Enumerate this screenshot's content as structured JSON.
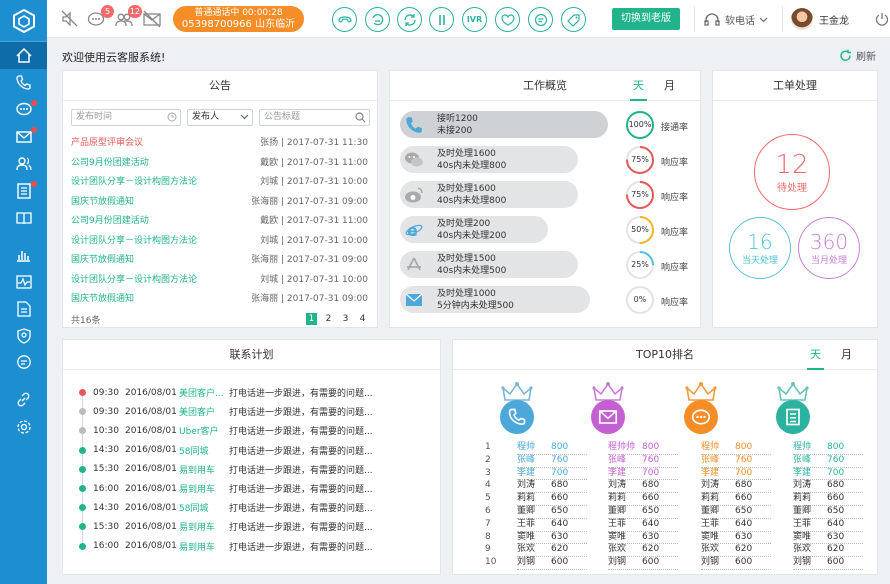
{
  "topbar": {
    "sms_badge": "5",
    "contacts_badge": "12",
    "call_status": "普通通话中 00:00:28",
    "call_number": "05398700966 山东临沂",
    "ivr_label": "IVR",
    "switch_old": "切换到老版",
    "softphone": "软电话",
    "user_name": "王金龙"
  },
  "welcome": "欢迎使用云客服系统!",
  "refresh": "刷新",
  "notice": {
    "title": "公告",
    "filter_time": "发布时间",
    "filter_person": "发布人",
    "filter_title": "公告标题",
    "items": [
      {
        "title": "产品原型评审会议",
        "meta": "张扬 | 2017-07-31 11:30",
        "red": true
      },
      {
        "title": "公司9月份团建活动",
        "meta": "戴欧 | 2017-07-31 11:00",
        "red": false
      },
      {
        "title": "设计团队分享－设计构图方法论",
        "meta": "刘城 | 2017-07-31 10:00",
        "red": false
      },
      {
        "title": "国庆节放假通知",
        "meta": "张海丽 | 2017-07-31 09:00",
        "red": false
      },
      {
        "title": "公司9月份团建活动",
        "meta": "戴欧 | 2017-07-31 11:00",
        "red": false
      },
      {
        "title": "设计团队分享－设计构图方法论",
        "meta": "刘城 | 2017-07-31 10:00",
        "red": false
      },
      {
        "title": "国庆节放假通知",
        "meta": "张海丽 | 2017-07-31 09:00",
        "red": false
      },
      {
        "title": "设计团队分享－设计构图方法论",
        "meta": "刘城 | 2017-07-31 10:00",
        "red": false
      },
      {
        "title": "国庆节放假通知",
        "meta": "张海丽 | 2017-07-31 09:00",
        "red": false
      }
    ],
    "total": "共16条",
    "pages": [
      "1",
      "2",
      "3",
      "4"
    ]
  },
  "overview": {
    "title": "工作概览",
    "tab_day": "天",
    "tab_month": "月",
    "rows": [
      {
        "icon": "phone-icon",
        "l1": "接听1200",
        "l2": "未接200",
        "pct": 100,
        "pct_label": "100%",
        "label": "接通率",
        "color": "#21b48a",
        "bar": "#cfd2d5"
      },
      {
        "icon": "wechat-icon",
        "l1": "及时处理1600",
        "l2": "40s内未处理800",
        "pct": 75,
        "pct_label": "75%",
        "label": "响应率",
        "color": "#e85757"
      },
      {
        "icon": "weibo-icon",
        "l1": "及时处理1600",
        "l2": "40s内未处理800",
        "pct": 75,
        "pct_label": "75%",
        "label": "响应率",
        "color": "#e85757"
      },
      {
        "icon": "ie-icon",
        "l1": "及时处理200",
        "l2": "40s内未处理200",
        "pct": 50,
        "pct_label": "50%",
        "label": "响应率",
        "color": "#f2b724"
      },
      {
        "icon": "app-icon",
        "l1": "及时处理1500",
        "l2": "40s内未处理500",
        "pct": 25,
        "pct_label": "25%",
        "label": "响应率",
        "color": "#4fc3d9"
      },
      {
        "icon": "mail-icon",
        "l1": "及时处理1000",
        "l2": "5分钟内未处理500",
        "pct": 0,
        "pct_label": "0%",
        "label": "响应率",
        "color": "#bbbbbb"
      }
    ]
  },
  "workorder": {
    "title": "工单处理",
    "pending": {
      "num": "12",
      "label": "待处理"
    },
    "today": {
      "num": "16",
      "label": "当天处理"
    },
    "month": {
      "num": "360",
      "label": "当月处理"
    }
  },
  "plan": {
    "title": "联系计划",
    "rows": [
      {
        "time": "09:30",
        "date": "2016/08/01",
        "customer": "美团客户...",
        "desc": "打电话进一步跟进，有需要的问题...",
        "dot": "#e85757"
      },
      {
        "time": "09:30",
        "date": "2016/08/01",
        "customer": "美团客户",
        "desc": "打电话进一步跟进，有需要的问题...",
        "dot": "#bbbbbb"
      },
      {
        "time": "10:30",
        "date": "2016/08/01",
        "customer": "Uber客户",
        "desc": "打电话进一步跟进，有需要的问题...",
        "dot": "#bbbbbb"
      },
      {
        "time": "14:30",
        "date": "2016/08/01",
        "customer": "58同城",
        "desc": "打电话进一步跟进，有需要的问题...",
        "dot": "#21b48a"
      },
      {
        "time": "15:30",
        "date": "2016/08/01",
        "customer": "易到用车",
        "desc": "打电话进一步跟进，有需要的问题...",
        "dot": "#21b48a"
      },
      {
        "time": "16:00",
        "date": "2016/08/01",
        "customer": "易到用车",
        "desc": "打电话进一步跟进，有需要的问题...",
        "dot": "#21b48a"
      },
      {
        "time": "14:30",
        "date": "2016/08/01",
        "customer": "58同城",
        "desc": "打电话进一步跟进，有需要的问题...",
        "dot": "#21b48a"
      },
      {
        "time": "15:30",
        "date": "2016/08/01",
        "customer": "易到用车",
        "desc": "打电话进一步跟进，有需要的问题...",
        "dot": "#21b48a"
      },
      {
        "time": "16:00",
        "date": "2016/08/01",
        "customer": "易到用车",
        "desc": "打电话进一步跟进，有需要的问题...",
        "dot": "#21b48a"
      }
    ]
  },
  "top10": {
    "title": "TOP10排名",
    "tab_day": "天",
    "tab_month": "月",
    "columns": [
      {
        "icon": "phone-icon",
        "color": "#4ba8d8",
        "crown": "#7bb6d9",
        "rows": [
          [
            "程帅",
            "800"
          ],
          [
            "张峰",
            "760"
          ],
          [
            "李建",
            "700"
          ],
          [
            "刘涛",
            "680"
          ],
          [
            "莉莉",
            "660"
          ],
          [
            "董卿",
            "650"
          ],
          [
            "王菲",
            "640"
          ],
          [
            "窦唯",
            "630"
          ],
          [
            "张欢",
            "620"
          ],
          [
            "刘钢",
            "600"
          ]
        ]
      },
      {
        "icon": "mail-icon",
        "color": "#c45fd1",
        "crown": "#c77fd6",
        "rows": [
          [
            "程帅帅",
            "800"
          ],
          [
            "张峰",
            "760"
          ],
          [
            "李建",
            "700"
          ],
          [
            "刘涛",
            "680"
          ],
          [
            "莉莉",
            "660"
          ],
          [
            "董卿",
            "650"
          ],
          [
            "王菲",
            "640"
          ],
          [
            "窦唯",
            "630"
          ],
          [
            "张欢",
            "620"
          ],
          [
            "刘钢",
            "600"
          ]
        ]
      },
      {
        "icon": "chat-icon",
        "color": "#f68d26",
        "crown": "#f39a3b",
        "rows": [
          [
            "程帅",
            "800"
          ],
          [
            "张峰",
            "760"
          ],
          [
            "李建",
            "700"
          ],
          [
            "刘涛",
            "680"
          ],
          [
            "莉莉",
            "660"
          ],
          [
            "董卿",
            "650"
          ],
          [
            "王菲",
            "640"
          ],
          [
            "窦唯",
            "630"
          ],
          [
            "张欢",
            "620"
          ],
          [
            "刘钢",
            "600"
          ]
        ]
      },
      {
        "icon": "doc-icon",
        "color": "#2bb3a0",
        "crown": "#67c3b8",
        "rows": [
          [
            "程帅",
            "800"
          ],
          [
            "张峰",
            "760"
          ],
          [
            "李建",
            "700"
          ],
          [
            "刘涛",
            "680"
          ],
          [
            "莉莉",
            "660"
          ],
          [
            "董卿",
            "650"
          ],
          [
            "王菲",
            "640"
          ],
          [
            "窦唯",
            "630"
          ],
          [
            "张欢",
            "620"
          ],
          [
            "刘钢",
            "600"
          ]
        ]
      }
    ],
    "ranks": [
      "1",
      "2",
      "3",
      "4",
      "5",
      "6",
      "7",
      "8",
      "9",
      "10"
    ]
  }
}
